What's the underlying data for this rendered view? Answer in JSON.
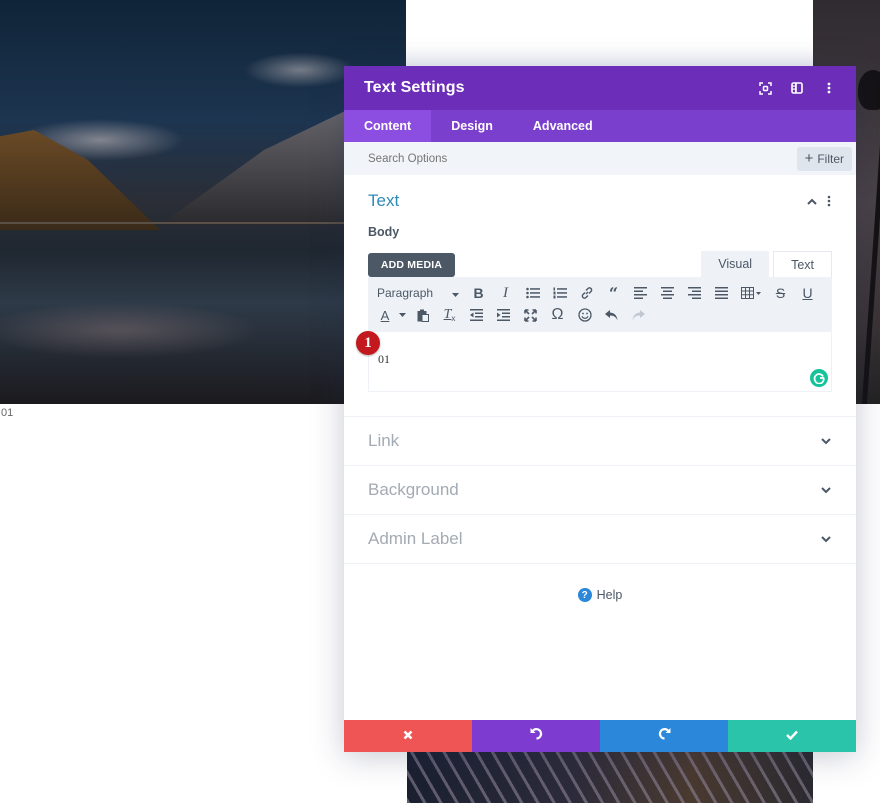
{
  "background": {
    "caption": "01"
  },
  "modal": {
    "title": "Text Settings",
    "header_icons": [
      "focus-icon",
      "split-view-icon",
      "more-options-icon"
    ],
    "tabs": [
      {
        "label": "Content",
        "active": true
      },
      {
        "label": "Design",
        "active": false
      },
      {
        "label": "Advanced",
        "active": false
      }
    ],
    "search": {
      "placeholder": "Search Options",
      "filter_label": "Filter"
    },
    "text_section": {
      "title": "Text",
      "body_label": "Body",
      "add_media_label": "ADD MEDIA",
      "editor_tabs": {
        "visual": "Visual",
        "text": "Text"
      },
      "format_select": "Paragraph",
      "content": "01",
      "badge": "1"
    },
    "sections": [
      {
        "title": "Link"
      },
      {
        "title": "Background"
      },
      {
        "title": "Admin Label"
      }
    ],
    "help_label": "Help"
  },
  "colors": {
    "header": "#6c2eb9",
    "tabs": "#7b3fce",
    "active_tab": "#8c4ee0",
    "section_title": "#2e8ab8",
    "cancel": "#ef5555",
    "undo": "#7e3bd0",
    "redo": "#2b87da",
    "save": "#29c4a9",
    "badge": "#c3181e"
  }
}
